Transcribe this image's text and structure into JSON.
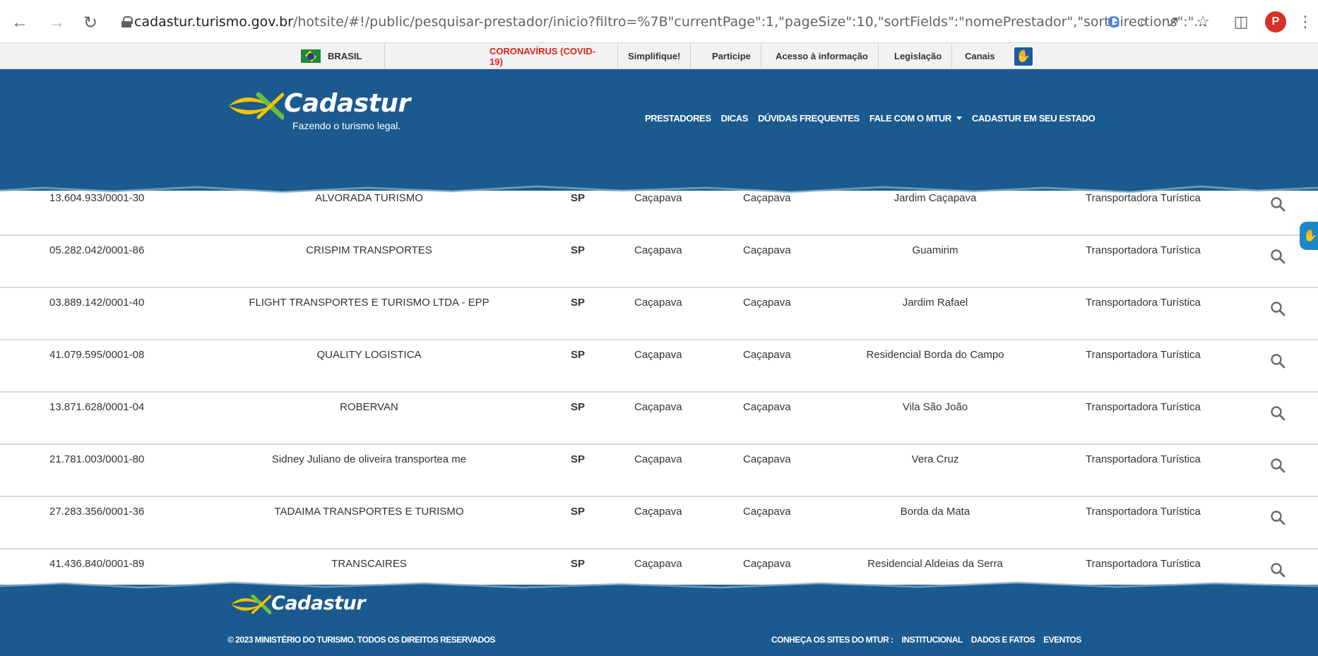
{
  "browser": {
    "url_domain": "cadastur.turismo.gov.br",
    "url_path": "/hotsite/#!/public/pesquisar-prestador/inicio?filtro=%7B\"currentPage\":1,\"pageSize\":10,\"sortFields\":\"nomePrestador\",\"sortDirections\":\"...",
    "profile_initial": "P",
    "google_letter": "G"
  },
  "govbar": {
    "brasil": "BRASIL",
    "covid": "CORONAVÍRUS (COVID-19)",
    "links": [
      "Simplifique!",
      "Participe",
      "Acesso à informação",
      "Legislação",
      "Canais"
    ]
  },
  "header": {
    "logo_text": "Cadastur",
    "logo_tagline": "Fazendo o turismo legal.",
    "nav": [
      "PRESTADORES",
      "DICAS",
      "DÚVIDAS FREQUENTES",
      "FALE COM O MTUR",
      "CADASTUR EM SEU ESTADO"
    ]
  },
  "rows": [
    {
      "cnpj": "13.604.933/0001-30",
      "name": "ALVORADA TURISMO",
      "uf": "SP",
      "city": "Caçapava",
      "city2": "Caçapava",
      "bairro": "Jardim Caçapava",
      "tipo": "Transportadora Turística"
    },
    {
      "cnpj": "05.282.042/0001-86",
      "name": "CRISPIM TRANSPORTES",
      "uf": "SP",
      "city": "Caçapava",
      "city2": "Caçapava",
      "bairro": "Guamirim",
      "tipo": "Transportadora Turística"
    },
    {
      "cnpj": "03.889.142/0001-40",
      "name": "FLIGHT TRANSPORTES E TURISMO LTDA - EPP",
      "uf": "SP",
      "city": "Caçapava",
      "city2": "Caçapava",
      "bairro": "Jardim Rafael",
      "tipo": "Transportadora Turística"
    },
    {
      "cnpj": "41.079.595/0001-08",
      "name": "QUALITY LOGISTICA",
      "uf": "SP",
      "city": "Caçapava",
      "city2": "Caçapava",
      "bairro": "Residencial Borda do Campo",
      "tipo": "Transportadora Turística"
    },
    {
      "cnpj": "13.871.628/0001-04",
      "name": "ROBERVAN",
      "uf": "SP",
      "city": "Caçapava",
      "city2": "Caçapava",
      "bairro": "Vila São João",
      "tipo": "Transportadora Turística"
    },
    {
      "cnpj": "21.781.003/0001-80",
      "name": "Sidney Juliano de oliveira transportea me",
      "uf": "SP",
      "city": "Caçapava",
      "city2": "Caçapava",
      "bairro": "Vera Cruz",
      "tipo": "Transportadora Turística"
    },
    {
      "cnpj": "27.283.356/0001-36",
      "name": "TADAIMA TRANSPORTES E TURISMO",
      "uf": "SP",
      "city": "Caçapava",
      "city2": "Caçapava",
      "bairro": "Borda da Mata",
      "tipo": "Transportadora Turística"
    },
    {
      "cnpj": "41.436.840/0001-89",
      "name": "TRANSCAIRES",
      "uf": "SP",
      "city": "Caçapava",
      "city2": "Caçapava",
      "bairro": "Residencial Aldeias da Serra",
      "tipo": "Transportadora Turística"
    }
  ],
  "footer": {
    "logo_text": "Cadastur",
    "copyright": "© 2023 MINISTÉRIO DO TURISMO. TODOS OS DIREITOS RESERVADOS",
    "sites_label": "CONHEÇA OS SITES DO MTUR :",
    "links": [
      "INSTITUCIONAL",
      "DADOS E FATOS",
      "EVENTOS"
    ]
  },
  "colors": {
    "brand_blue": "#1b5a8f",
    "logo_yellow": "#f2c200",
    "logo_green": "#6abf3f",
    "covid_red": "#e2231a"
  }
}
